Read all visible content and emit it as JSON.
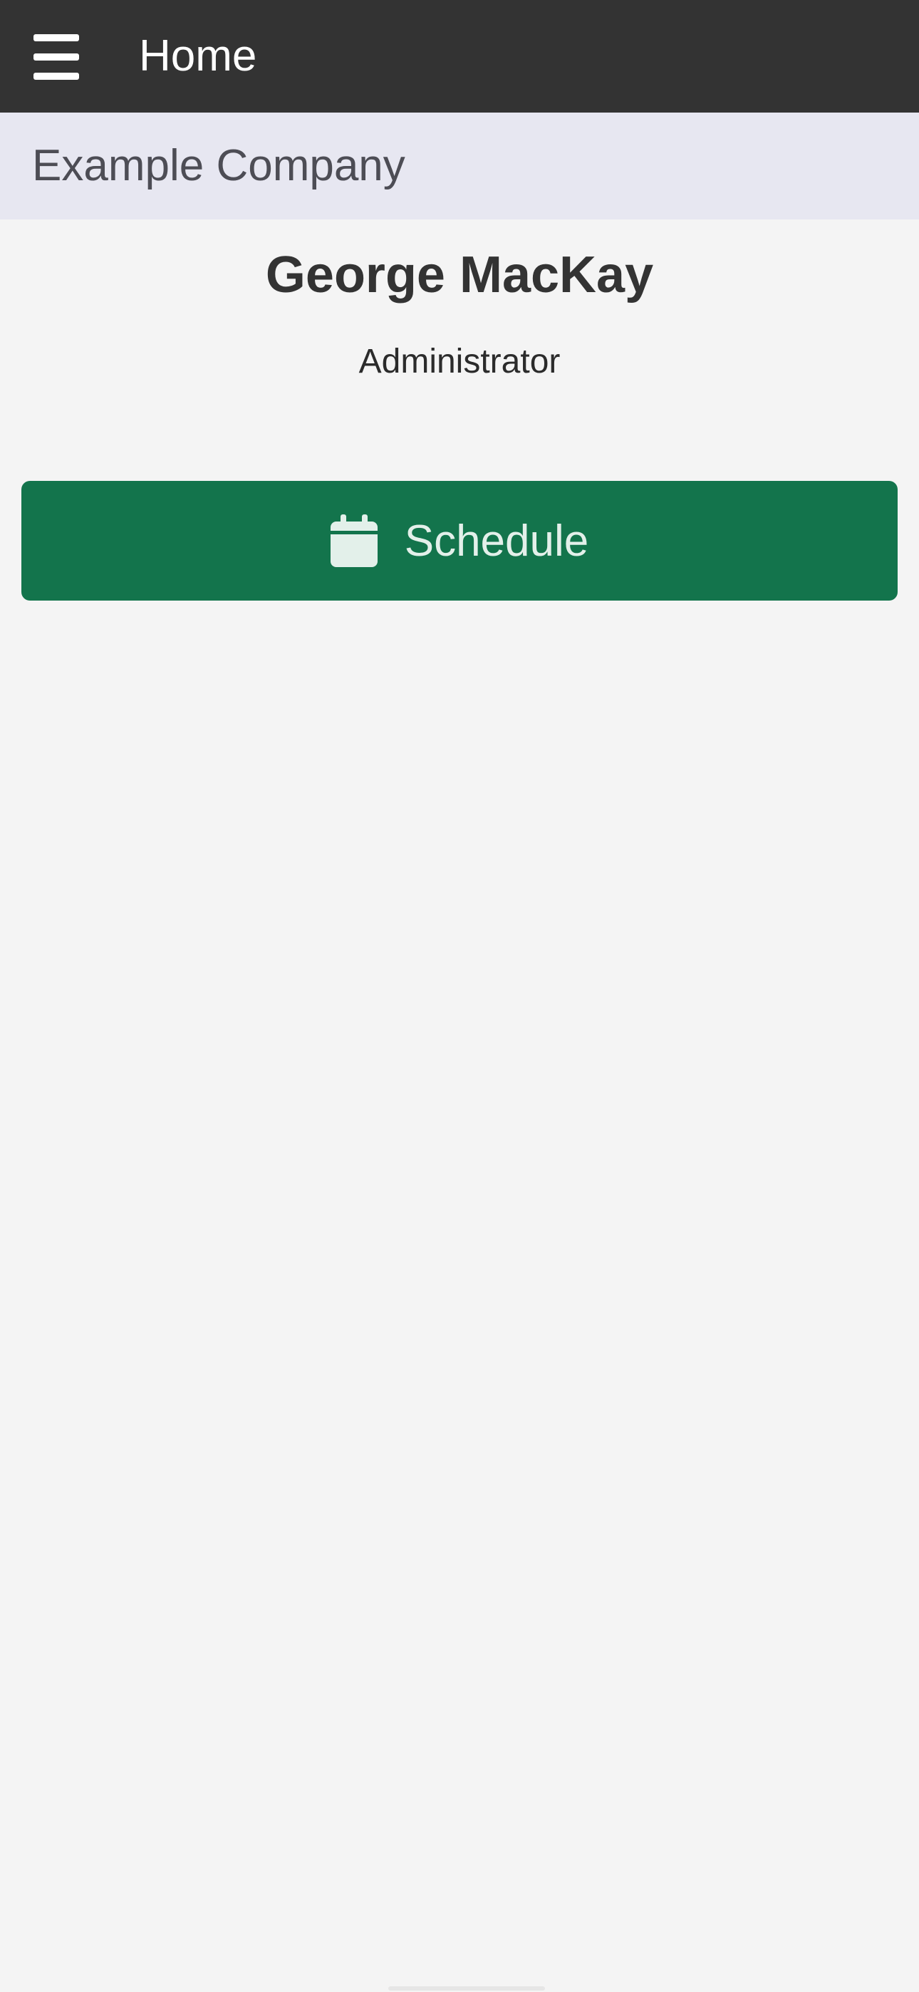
{
  "header": {
    "title": "Home",
    "menu_icon": "hamburger-menu-icon"
  },
  "company": {
    "name": "Example Company"
  },
  "user": {
    "name": "George MacKay",
    "role": "Administrator"
  },
  "actions": {
    "schedule_label": "Schedule",
    "schedule_icon": "calendar-icon"
  },
  "colors": {
    "header_bg": "#333333",
    "banner_bg": "#e7e7f1",
    "page_bg": "#f4f4f4",
    "accent": "#13744c"
  }
}
